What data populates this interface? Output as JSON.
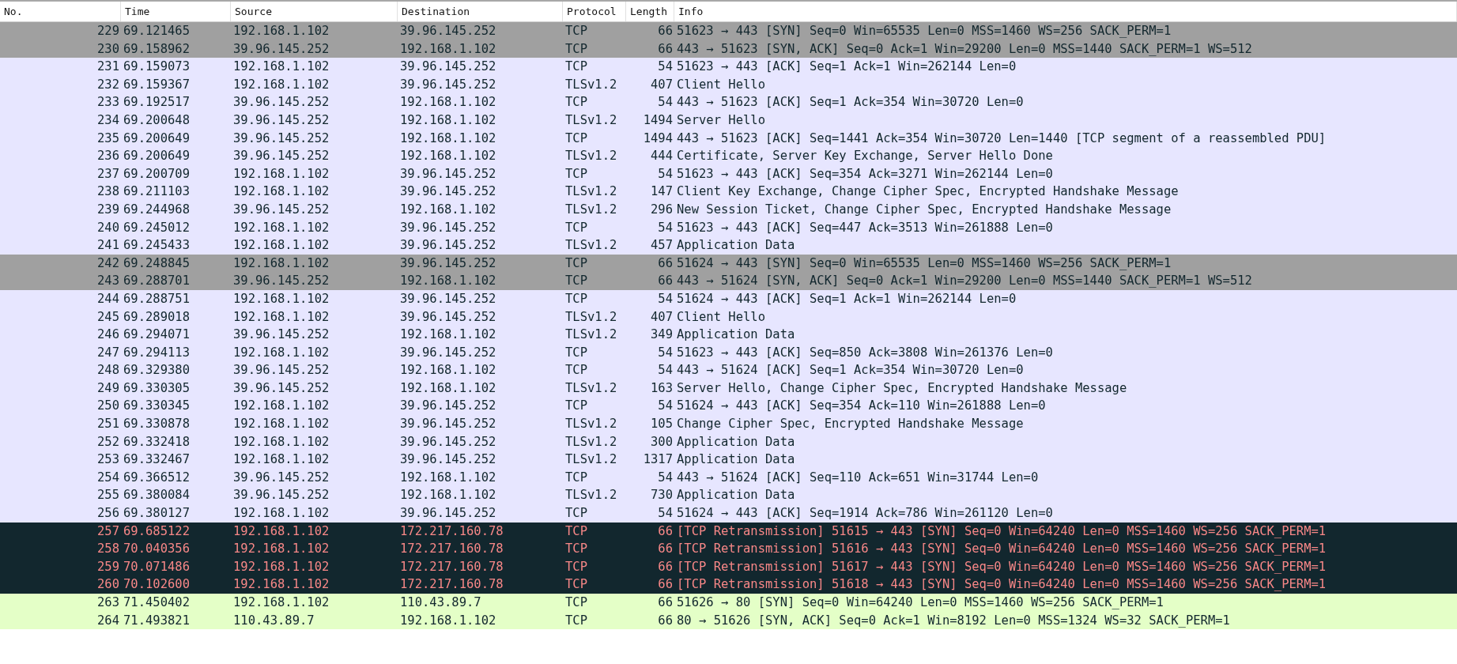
{
  "table": {
    "columns": [
      "No.",
      "Time",
      "Source",
      "Destination",
      "Protocol",
      "Length",
      "Info"
    ],
    "rows": [
      {
        "kind": "syn",
        "no": "229",
        "time": "69.121465",
        "source": "192.168.1.102",
        "destination": "39.96.145.252",
        "protocol": "TCP",
        "length": "66",
        "info": "51623 → 443 [SYN] Seq=0 Win=65535 Len=0 MSS=1460 WS=256 SACK_PERM=1"
      },
      {
        "kind": "syn",
        "no": "230",
        "time": "69.158962",
        "source": "39.96.145.252",
        "destination": "192.168.1.102",
        "protocol": "TCP",
        "length": "66",
        "info": "443 → 51623 [SYN, ACK] Seq=0 Ack=1 Win=29200 Len=0 MSS=1440 SACK_PERM=1 WS=512"
      },
      {
        "kind": "normal",
        "no": "231",
        "time": "69.159073",
        "source": "192.168.1.102",
        "destination": "39.96.145.252",
        "protocol": "TCP",
        "length": "54",
        "info": "51623 → 443 [ACK] Seq=1 Ack=1 Win=262144 Len=0"
      },
      {
        "kind": "normal",
        "no": "232",
        "time": "69.159367",
        "source": "192.168.1.102",
        "destination": "39.96.145.252",
        "protocol": "TLSv1.2",
        "length": "407",
        "info": "Client Hello"
      },
      {
        "kind": "normal",
        "no": "233",
        "time": "69.192517",
        "source": "39.96.145.252",
        "destination": "192.168.1.102",
        "protocol": "TCP",
        "length": "54",
        "info": "443 → 51623 [ACK] Seq=1 Ack=354 Win=30720 Len=0"
      },
      {
        "kind": "normal",
        "no": "234",
        "time": "69.200648",
        "source": "39.96.145.252",
        "destination": "192.168.1.102",
        "protocol": "TLSv1.2",
        "length": "1494",
        "info": "Server Hello"
      },
      {
        "kind": "normal",
        "no": "235",
        "time": "69.200649",
        "source": "39.96.145.252",
        "destination": "192.168.1.102",
        "protocol": "TCP",
        "length": "1494",
        "info": "443 → 51623 [ACK] Seq=1441 Ack=354 Win=30720 Len=1440 [TCP segment of a reassembled PDU]"
      },
      {
        "kind": "normal",
        "no": "236",
        "time": "69.200649",
        "source": "39.96.145.252",
        "destination": "192.168.1.102",
        "protocol": "TLSv1.2",
        "length": "444",
        "info": "Certificate, Server Key Exchange, Server Hello Done"
      },
      {
        "kind": "normal",
        "no": "237",
        "time": "69.200709",
        "source": "192.168.1.102",
        "destination": "39.96.145.252",
        "protocol": "TCP",
        "length": "54",
        "info": "51623 → 443 [ACK] Seq=354 Ack=3271 Win=262144 Len=0"
      },
      {
        "kind": "normal",
        "no": "238",
        "time": "69.211103",
        "source": "192.168.1.102",
        "destination": "39.96.145.252",
        "protocol": "TLSv1.2",
        "length": "147",
        "info": "Client Key Exchange, Change Cipher Spec, Encrypted Handshake Message"
      },
      {
        "kind": "normal",
        "no": "239",
        "time": "69.244968",
        "source": "39.96.145.252",
        "destination": "192.168.1.102",
        "protocol": "TLSv1.2",
        "length": "296",
        "info": "New Session Ticket, Change Cipher Spec, Encrypted Handshake Message"
      },
      {
        "kind": "normal",
        "no": "240",
        "time": "69.245012",
        "source": "192.168.1.102",
        "destination": "39.96.145.252",
        "protocol": "TCP",
        "length": "54",
        "info": "51623 → 443 [ACK] Seq=447 Ack=3513 Win=261888 Len=0"
      },
      {
        "kind": "normal",
        "no": "241",
        "time": "69.245433",
        "source": "192.168.1.102",
        "destination": "39.96.145.252",
        "protocol": "TLSv1.2",
        "length": "457",
        "info": "Application Data"
      },
      {
        "kind": "syn",
        "no": "242",
        "time": "69.248845",
        "source": "192.168.1.102",
        "destination": "39.96.145.252",
        "protocol": "TCP",
        "length": "66",
        "info": "51624 → 443 [SYN] Seq=0 Win=65535 Len=0 MSS=1460 WS=256 SACK_PERM=1"
      },
      {
        "kind": "syn",
        "no": "243",
        "time": "69.288701",
        "source": "39.96.145.252",
        "destination": "192.168.1.102",
        "protocol": "TCP",
        "length": "66",
        "info": "443 → 51624 [SYN, ACK] Seq=0 Ack=1 Win=29200 Len=0 MSS=1440 SACK_PERM=1 WS=512"
      },
      {
        "kind": "normal",
        "no": "244",
        "time": "69.288751",
        "source": "192.168.1.102",
        "destination": "39.96.145.252",
        "protocol": "TCP",
        "length": "54",
        "info": "51624 → 443 [ACK] Seq=1 Ack=1 Win=262144 Len=0"
      },
      {
        "kind": "normal",
        "no": "245",
        "time": "69.289018",
        "source": "192.168.1.102",
        "destination": "39.96.145.252",
        "protocol": "TLSv1.2",
        "length": "407",
        "info": "Client Hello"
      },
      {
        "kind": "normal",
        "no": "246",
        "time": "69.294071",
        "source": "39.96.145.252",
        "destination": "192.168.1.102",
        "protocol": "TLSv1.2",
        "length": "349",
        "info": "Application Data"
      },
      {
        "kind": "normal",
        "no": "247",
        "time": "69.294113",
        "source": "192.168.1.102",
        "destination": "39.96.145.252",
        "protocol": "TCP",
        "length": "54",
        "info": "51623 → 443 [ACK] Seq=850 Ack=3808 Win=261376 Len=0"
      },
      {
        "kind": "normal",
        "no": "248",
        "time": "69.329380",
        "source": "39.96.145.252",
        "destination": "192.168.1.102",
        "protocol": "TCP",
        "length": "54",
        "info": "443 → 51624 [ACK] Seq=1 Ack=354 Win=30720 Len=0"
      },
      {
        "kind": "normal",
        "no": "249",
        "time": "69.330305",
        "source": "39.96.145.252",
        "destination": "192.168.1.102",
        "protocol": "TLSv1.2",
        "length": "163",
        "info": "Server Hello, Change Cipher Spec, Encrypted Handshake Message"
      },
      {
        "kind": "normal",
        "no": "250",
        "time": "69.330345",
        "source": "192.168.1.102",
        "destination": "39.96.145.252",
        "protocol": "TCP",
        "length": "54",
        "info": "51624 → 443 [ACK] Seq=354 Ack=110 Win=261888 Len=0"
      },
      {
        "kind": "normal",
        "no": "251",
        "time": "69.330878",
        "source": "192.168.1.102",
        "destination": "39.96.145.252",
        "protocol": "TLSv1.2",
        "length": "105",
        "info": "Change Cipher Spec, Encrypted Handshake Message"
      },
      {
        "kind": "normal",
        "no": "252",
        "time": "69.332418",
        "source": "192.168.1.102",
        "destination": "39.96.145.252",
        "protocol": "TLSv1.2",
        "length": "300",
        "info": "Application Data"
      },
      {
        "kind": "normal",
        "no": "253",
        "time": "69.332467",
        "source": "192.168.1.102",
        "destination": "39.96.145.252",
        "protocol": "TLSv1.2",
        "length": "1317",
        "info": "Application Data"
      },
      {
        "kind": "normal",
        "no": "254",
        "time": "69.366512",
        "source": "39.96.145.252",
        "destination": "192.168.1.102",
        "protocol": "TCP",
        "length": "54",
        "info": "443 → 51624 [ACK] Seq=110 Ack=651 Win=31744 Len=0"
      },
      {
        "kind": "normal",
        "no": "255",
        "time": "69.380084",
        "source": "39.96.145.252",
        "destination": "192.168.1.102",
        "protocol": "TLSv1.2",
        "length": "730",
        "info": "Application Data"
      },
      {
        "kind": "normal",
        "no": "256",
        "time": "69.380127",
        "source": "192.168.1.102",
        "destination": "39.96.145.252",
        "protocol": "TCP",
        "length": "54",
        "info": "51624 → 443 [ACK] Seq=1914 Ack=786 Win=261120 Len=0"
      },
      {
        "kind": "error",
        "no": "257",
        "time": "69.685122",
        "source": "192.168.1.102",
        "destination": "172.217.160.78",
        "protocol": "TCP",
        "length": "66",
        "info": "[TCP Retransmission] 51615 → 443 [SYN] Seq=0 Win=64240 Len=0 MSS=1460 WS=256 SACK_PERM=1"
      },
      {
        "kind": "error",
        "no": "258",
        "time": "70.040356",
        "source": "192.168.1.102",
        "destination": "172.217.160.78",
        "protocol": "TCP",
        "length": "66",
        "info": "[TCP Retransmission] 51616 → 443 [SYN] Seq=0 Win=64240 Len=0 MSS=1460 WS=256 SACK_PERM=1"
      },
      {
        "kind": "error",
        "no": "259",
        "time": "70.071486",
        "source": "192.168.1.102",
        "destination": "172.217.160.78",
        "protocol": "TCP",
        "length": "66",
        "info": "[TCP Retransmission] 51617 → 443 [SYN] Seq=0 Win=64240 Len=0 MSS=1460 WS=256 SACK_PERM=1"
      },
      {
        "kind": "error",
        "no": "260",
        "time": "70.102600",
        "source": "192.168.1.102",
        "destination": "172.217.160.78",
        "protocol": "TCP",
        "length": "66",
        "info": "[TCP Retransmission] 51618 → 443 [SYN] Seq=0 Win=64240 Len=0 MSS=1460 WS=256 SACK_PERM=1"
      },
      {
        "kind": "http",
        "no": "263",
        "time": "71.450402",
        "source": "192.168.1.102",
        "destination": "110.43.89.7",
        "protocol": "TCP",
        "length": "66",
        "info": "51626 → 80 [SYN] Seq=0 Win=64240 Len=0 MSS=1460 WS=256 SACK_PERM=1"
      },
      {
        "kind": "http",
        "no": "264",
        "time": "71.493821",
        "source": "110.43.89.7",
        "destination": "192.168.1.102",
        "protocol": "TCP",
        "length": "66",
        "info": "80 → 51626 [SYN, ACK] Seq=0 Ack=1 Win=8192 Len=0 MSS=1324 WS=32 SACK_PERM=1"
      }
    ]
  }
}
